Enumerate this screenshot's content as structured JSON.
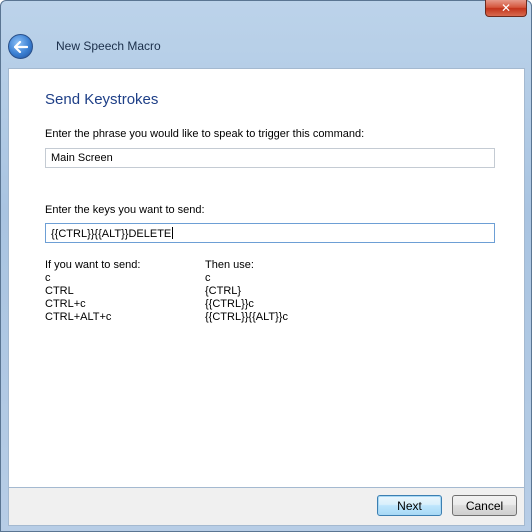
{
  "window": {
    "close_glyph": "✕"
  },
  "header": {
    "title": "New Speech Macro"
  },
  "content": {
    "heading": "Send Keystrokes",
    "phrase_label": "Enter the phrase you would like to speak to trigger this command:",
    "phrase_value": "Main Screen",
    "keys_label": "Enter the keys you want to send:",
    "keys_value": "{{CTRL}}{{ALT}}DELETE",
    "table": {
      "left_header": "If you want to send:",
      "right_header": "Then use:",
      "rows": [
        {
          "send": "c",
          "use": "c"
        },
        {
          "send": "CTRL",
          "use": "{CTRL}"
        },
        {
          "send": "CTRL+c",
          "use": "{{CTRL}}c"
        },
        {
          "send": "CTRL+ALT+c",
          "use": "{{CTRL}}{{ALT}}c"
        }
      ]
    }
  },
  "footer": {
    "next_label": "Next",
    "cancel_label": "Cancel"
  },
  "icons": {
    "back": "back-arrow-icon",
    "close": "close-icon"
  },
  "colors": {
    "heading": "#1e3f87",
    "default_button_border": "#3c7fb1",
    "close_button": "#c2331b"
  }
}
